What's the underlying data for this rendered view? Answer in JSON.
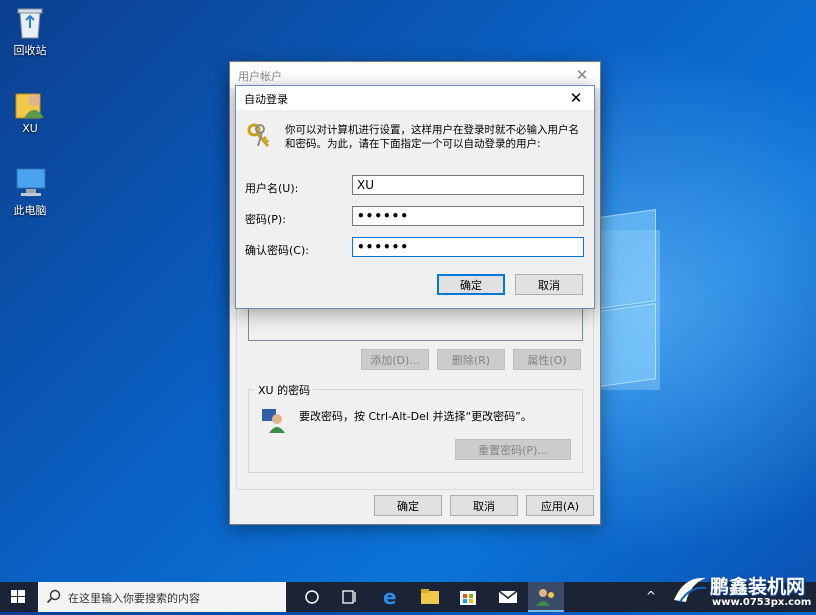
{
  "desktop": {
    "icons": [
      {
        "label": "回收站",
        "icon": "recycle-bin-icon"
      },
      {
        "label": "XU",
        "icon": "user-folder-icon"
      },
      {
        "label": "此电脑",
        "icon": "computer-icon"
      }
    ]
  },
  "user_accounts_window": {
    "title": "用户帐户",
    "buttons": {
      "add": "添加(D)...",
      "remove": "删除(R)",
      "properties": "属性(O)"
    },
    "password_group": {
      "title": "XU 的密码",
      "text": "要改密码，按 Ctrl-Alt-Del 并选择“更改密码”。",
      "reset_button": "重置密码(P)..."
    },
    "footer": {
      "ok": "确定",
      "cancel": "取消",
      "apply": "应用(A)"
    }
  },
  "autologon_dialog": {
    "title": "自动登录",
    "description": "你可以对计算机进行设置，这样用户在登录时就不必输入用户名和密码。为此，请在下面指定一个可以自动登录的用户:",
    "fields": {
      "username_label": "用户名(U):",
      "username_value": "XU",
      "password_label": "密码(P):",
      "password_value": "••••••",
      "confirm_label": "确认密码(C):",
      "confirm_value": "••••••"
    },
    "ok": "确定",
    "cancel": "取消"
  },
  "taskbar": {
    "search_placeholder": "在这里输入你要搜索的内容"
  },
  "watermark": {
    "text": "鹏鑫装机网",
    "url": "www.0753px.com"
  },
  "colors": {
    "accent": "#0078d7",
    "taskbar": "#1b2437"
  }
}
